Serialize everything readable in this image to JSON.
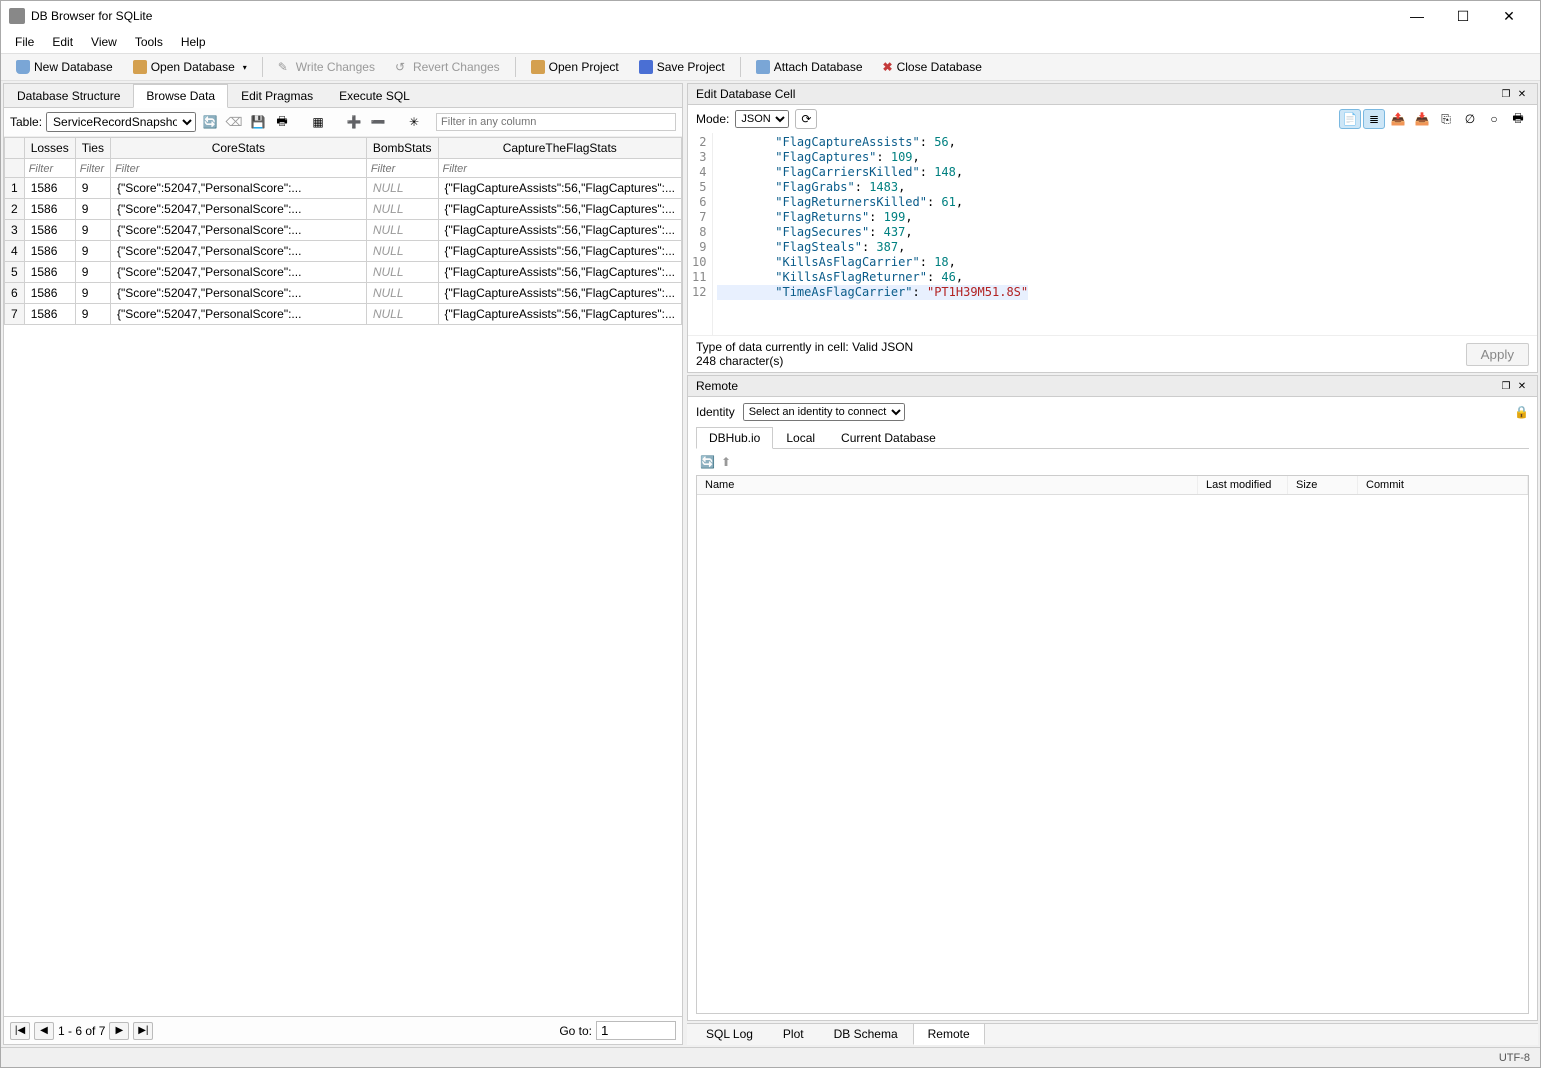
{
  "window": {
    "title": "DB Browser for SQLite"
  },
  "menus": [
    "File",
    "Edit",
    "View",
    "Tools",
    "Help"
  ],
  "toolbar": {
    "new_db": "New Database",
    "open_db": "Open Database",
    "write_changes": "Write Changes",
    "revert_changes": "Revert Changes",
    "open_project": "Open Project",
    "save_project": "Save Project",
    "attach_db": "Attach Database",
    "close_db": "Close Database"
  },
  "tabs": {
    "structure": "Database Structure",
    "browse": "Browse Data",
    "pragmas": "Edit Pragmas",
    "sql": "Execute SQL"
  },
  "browse": {
    "table_label": "Table:",
    "table_select": "ServiceRecordSnapshots",
    "filter_placeholder": "Filter in any column",
    "columns": [
      "Losses",
      "Ties",
      "CoreStats",
      "BombStats",
      "CaptureTheFlagStats"
    ],
    "filter_text": "Filter",
    "rows": [
      {
        "n": "1",
        "losses": "1586",
        "ties": "9",
        "core": "{\"Score\":52047,\"PersonalScore\":...",
        "bomb": "NULL",
        "ctf": "{\"FlagCaptureAssists\":56,\"FlagCaptures\":..."
      },
      {
        "n": "2",
        "losses": "1586",
        "ties": "9",
        "core": "{\"Score\":52047,\"PersonalScore\":...",
        "bomb": "NULL",
        "ctf": "{\"FlagCaptureAssists\":56,\"FlagCaptures\":..."
      },
      {
        "n": "3",
        "losses": "1586",
        "ties": "9",
        "core": "{\"Score\":52047,\"PersonalScore\":...",
        "bomb": "NULL",
        "ctf": "{\"FlagCaptureAssists\":56,\"FlagCaptures\":..."
      },
      {
        "n": "4",
        "losses": "1586",
        "ties": "9",
        "core": "{\"Score\":52047,\"PersonalScore\":...",
        "bomb": "NULL",
        "ctf": "{\"FlagCaptureAssists\":56,\"FlagCaptures\":..."
      },
      {
        "n": "5",
        "losses": "1586",
        "ties": "9",
        "core": "{\"Score\":52047,\"PersonalScore\":...",
        "bomb": "NULL",
        "ctf": "{\"FlagCaptureAssists\":56,\"FlagCaptures\":..."
      },
      {
        "n": "6",
        "losses": "1586",
        "ties": "9",
        "core": "{\"Score\":52047,\"PersonalScore\":...",
        "bomb": "NULL",
        "ctf": "{\"FlagCaptureAssists\":56,\"FlagCaptures\":..."
      },
      {
        "n": "7",
        "losses": "1586",
        "ties": "9",
        "core": "{\"Score\":52047,\"PersonalScore\":...",
        "bomb": "NULL",
        "ctf": "{\"FlagCaptureAssists\":56,\"FlagCaptures\":..."
      }
    ],
    "nav": {
      "range": "1 - 6 of 7",
      "goto_label": "Go to:",
      "goto_value": "1"
    }
  },
  "editcell": {
    "title": "Edit Database Cell",
    "mode_label": "Mode:",
    "mode_value": "JSON",
    "lines": [
      {
        "n": "2",
        "key": "FlagCaptureAssists",
        "val": "56",
        "tail": ","
      },
      {
        "n": "3",
        "key": "FlagCaptures",
        "val": "109",
        "tail": ","
      },
      {
        "n": "4",
        "key": "FlagCarriersKilled",
        "val": "148",
        "tail": ","
      },
      {
        "n": "5",
        "key": "FlagGrabs",
        "val": "1483",
        "tail": ","
      },
      {
        "n": "6",
        "key": "FlagReturnersKilled",
        "val": "61",
        "tail": ","
      },
      {
        "n": "7",
        "key": "FlagReturns",
        "val": "199",
        "tail": ","
      },
      {
        "n": "8",
        "key": "FlagSecures",
        "val": "437",
        "tail": ","
      },
      {
        "n": "9",
        "key": "FlagSteals",
        "val": "387",
        "tail": ","
      },
      {
        "n": "10",
        "key": "KillsAsFlagCarrier",
        "val": "18",
        "tail": ","
      },
      {
        "n": "11",
        "key": "KillsAsFlagReturner",
        "val": "46",
        "tail": ","
      }
    ],
    "hl_line": {
      "n": "12",
      "key": "TimeAsFlagCarrier",
      "val": "\"PT1H39M51.8S\"",
      "tail": ""
    },
    "status_type": "Type of data currently in cell: Valid JSON",
    "status_len": "248 character(s)",
    "apply": "Apply"
  },
  "remote": {
    "title": "Remote",
    "identity_label": "Identity",
    "identity_value": "Select an identity to connect",
    "tabs": [
      "DBHub.io",
      "Local",
      "Current Database"
    ],
    "list_headers": [
      "Name",
      "Last modified",
      "Size",
      "Commit"
    ]
  },
  "bottom_tabs": [
    "SQL Log",
    "Plot",
    "DB Schema",
    "Remote"
  ],
  "status": {
    "encoding": "UTF-8"
  }
}
